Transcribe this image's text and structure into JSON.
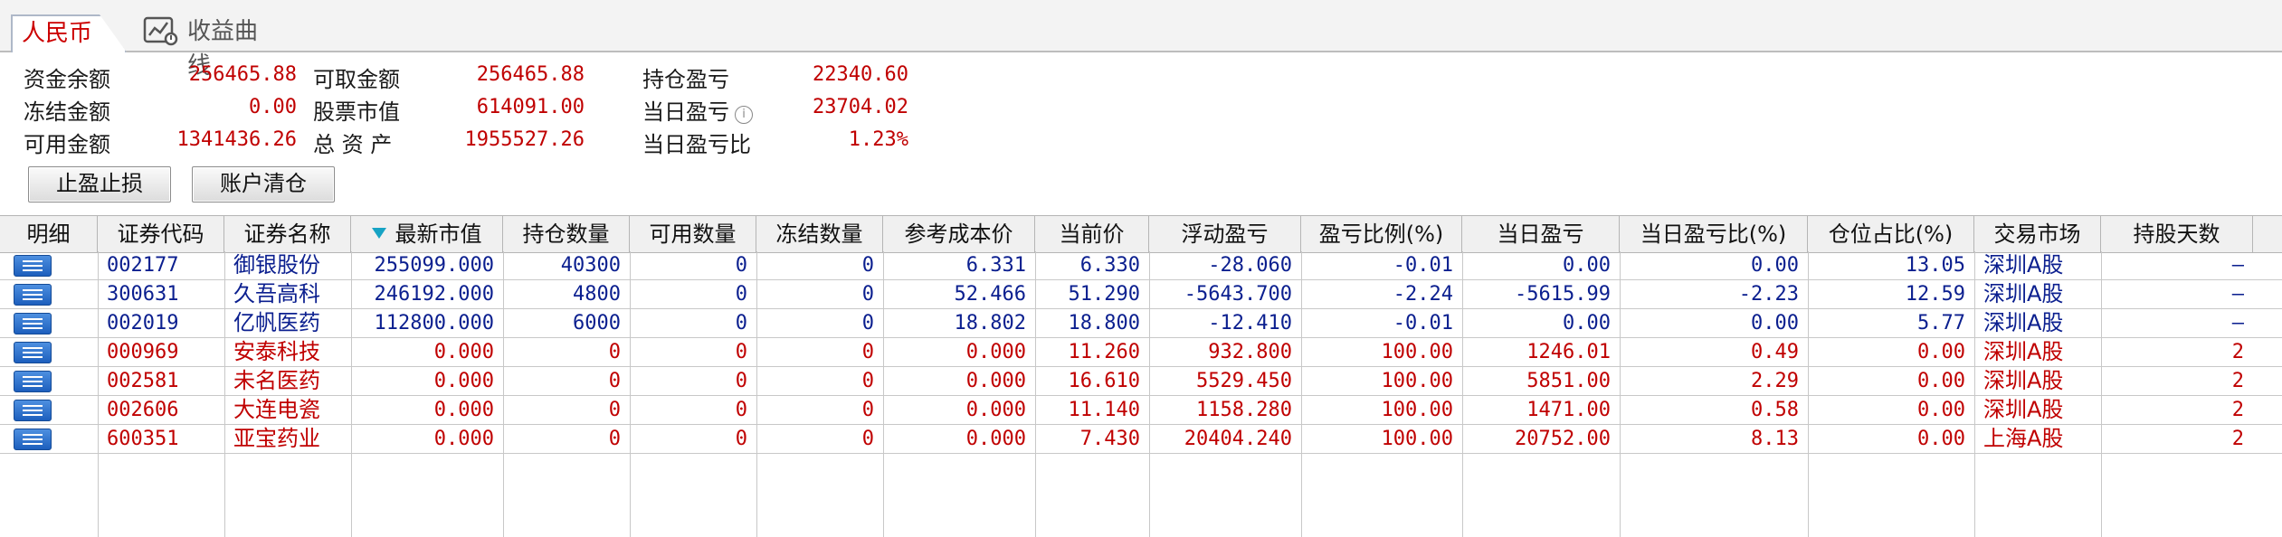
{
  "tabs": {
    "active": "人民币",
    "curve": "收益曲线"
  },
  "summary": {
    "balance_label": "资金余额",
    "balance_value": "256465.88",
    "withdrawable_label": "可取金额",
    "withdrawable_value": "256465.88",
    "position_pl_label": "持仓盈亏",
    "position_pl_value": "22340.60",
    "frozen_label": "冻结金额",
    "frozen_value": "0.00",
    "stock_value_label": "股票市值",
    "stock_value_value": "614091.00",
    "today_pl_label": "当日盈亏",
    "today_pl_value": "23704.02",
    "available_label": "可用金额",
    "available_value": "1341436.26",
    "total_assets_label": "总 资 产",
    "total_assets_value": "1955527.26",
    "today_pl_ratio_label": "当日盈亏比",
    "today_pl_ratio_value": "1.23%"
  },
  "buttons": {
    "stop": "止盈止损",
    "clear": "账户清仓"
  },
  "columns": [
    "明细",
    "证券代码",
    "证券名称",
    "最新市值",
    "持仓数量",
    "可用数量",
    "冻结数量",
    "参考成本价",
    "当前价",
    "浮动盈亏",
    "盈亏比例(%)",
    "当日盈亏",
    "当日盈亏比(%)",
    "仓位占比(%)",
    "交易市场",
    "持股天数"
  ],
  "rows": [
    {
      "code": "002177",
      "name": "御银股份",
      "mv": "255099.000",
      "qty": "40300",
      "avail": "0",
      "frozen": "0",
      "cost": "6.331",
      "price": "6.330",
      "fpl": "-28.060",
      "plr": "-0.01",
      "dpl": "0.00",
      "dplr": "0.00",
      "pos": "13.05",
      "market": "深圳A股",
      "days": "—",
      "color": "blue"
    },
    {
      "code": "300631",
      "name": "久吾高科",
      "mv": "246192.000",
      "qty": "4800",
      "avail": "0",
      "frozen": "0",
      "cost": "52.466",
      "price": "51.290",
      "fpl": "-5643.700",
      "plr": "-2.24",
      "dpl": "-5615.99",
      "dplr": "-2.23",
      "pos": "12.59",
      "market": "深圳A股",
      "days": "—",
      "color": "blue"
    },
    {
      "code": "002019",
      "name": "亿帆医药",
      "mv": "112800.000",
      "qty": "6000",
      "avail": "0",
      "frozen": "0",
      "cost": "18.802",
      "price": "18.800",
      "fpl": "-12.410",
      "plr": "-0.01",
      "dpl": "0.00",
      "dplr": "0.00",
      "pos": "5.77",
      "market": "深圳A股",
      "days": "—",
      "color": "blue"
    },
    {
      "code": "000969",
      "name": "安泰科技",
      "mv": "0.000",
      "qty": "0",
      "avail": "0",
      "frozen": "0",
      "cost": "0.000",
      "price": "11.260",
      "fpl": "932.800",
      "plr": "100.00",
      "dpl": "1246.01",
      "dplr": "0.49",
      "pos": "0.00",
      "market": "深圳A股",
      "days": "2",
      "color": "red"
    },
    {
      "code": "002581",
      "name": "未名医药",
      "mv": "0.000",
      "qty": "0",
      "avail": "0",
      "frozen": "0",
      "cost": "0.000",
      "price": "16.610",
      "fpl": "5529.450",
      "plr": "100.00",
      "dpl": "5851.00",
      "dplr": "2.29",
      "pos": "0.00",
      "market": "深圳A股",
      "days": "2",
      "color": "red"
    },
    {
      "code": "002606",
      "name": "大连电瓷",
      "mv": "0.000",
      "qty": "0",
      "avail": "0",
      "frozen": "0",
      "cost": "0.000",
      "price": "11.140",
      "fpl": "1158.280",
      "plr": "100.00",
      "dpl": "1471.00",
      "dplr": "0.58",
      "pos": "0.00",
      "market": "深圳A股",
      "days": "2",
      "color": "red"
    },
    {
      "code": "600351",
      "name": "亚宝药业",
      "mv": "0.000",
      "qty": "0",
      "avail": "0",
      "frozen": "0",
      "cost": "0.000",
      "price": "7.430",
      "fpl": "20404.240",
      "plr": "100.00",
      "dpl": "20752.00",
      "dplr": "8.13",
      "pos": "0.00",
      "market": "上海A股",
      "days": "2",
      "color": "red"
    }
  ]
}
